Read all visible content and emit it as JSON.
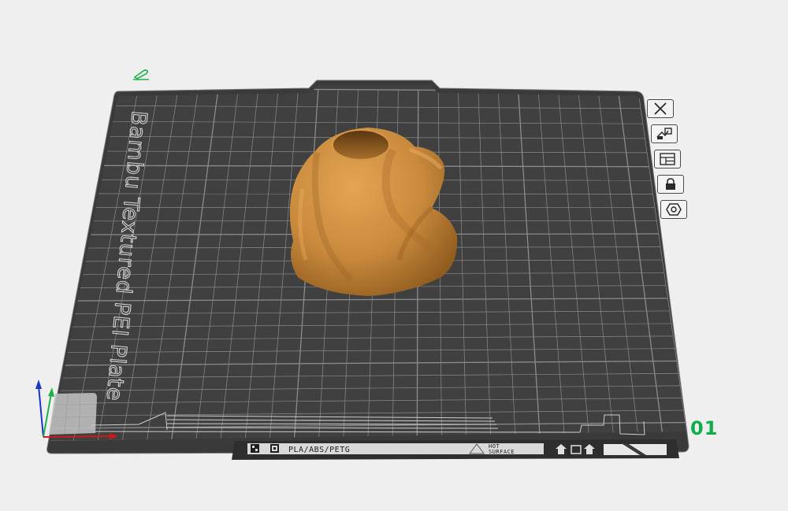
{
  "plate": {
    "name_label": "Bambu Textured PEI Plate",
    "filament_types": "PLA/ABS/PETG",
    "surface_line1": "HOT",
    "surface_line2": "SURFACE",
    "number": "01"
  },
  "colors": {
    "background": "#efefef",
    "plate": "#3c3c3c",
    "grid": "#8a8a8a",
    "model": "#c98a3c",
    "plate_number": "#0fae4c",
    "axis_x": "#d0181b",
    "axis_y": "#1fb24a",
    "axis_z": "#1a36c8"
  },
  "tools": [
    {
      "name": "remove-plate",
      "icon": "close-icon"
    },
    {
      "name": "auto-arrange",
      "icon": "arrange-icon"
    },
    {
      "name": "plate-settings",
      "icon": "layout-icon"
    },
    {
      "name": "lock-plate",
      "icon": "lock-icon"
    },
    {
      "name": "plate-type",
      "icon": "hexagon-icon"
    }
  ],
  "icons": {
    "edit": "pencil-icon"
  }
}
